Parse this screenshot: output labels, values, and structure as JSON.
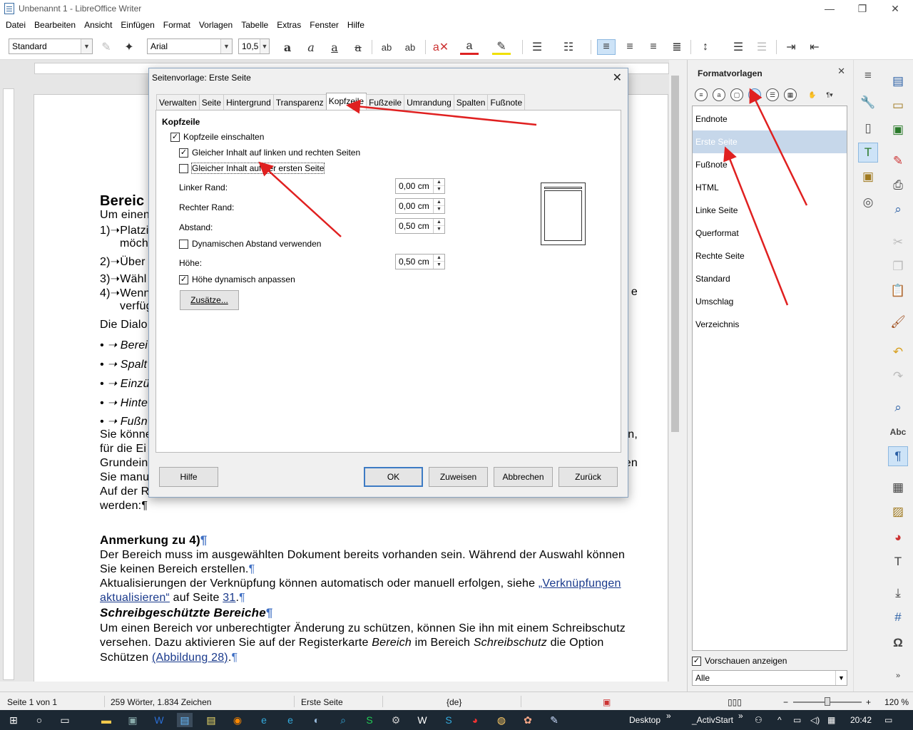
{
  "window": {
    "title": "Unbenannt 1 - LibreOffice Writer",
    "controls": [
      "—",
      "❐",
      "✕"
    ]
  },
  "menu": [
    "Datei",
    "Bearbeiten",
    "Ansicht",
    "Einfügen",
    "Format",
    "Vorlagen",
    "Tabelle",
    "Extras",
    "Fenster",
    "Hilfe"
  ],
  "toolbar": {
    "paragraph_style": "Standard",
    "font_name": "Arial",
    "font_size": "10,5"
  },
  "document": {
    "lines": [
      {
        "text": "Bereic",
        "style": "heading"
      },
      {
        "text": "Um einen"
      },
      {
        "text": "1)➝Platzi"
      },
      {
        "text": "möch",
        "indent": true
      },
      {
        "text": "2)➝Über"
      },
      {
        "text": "3)➝Wähl"
      },
      {
        "text": "4)➝Wenn",
        "tail": "e"
      },
      {
        "text": "verfüg",
        "indent": true
      },
      {
        "text": "Die Dialo"
      },
      {
        "text": "• ➝ Berei",
        "style": "italic"
      },
      {
        "text": "• ➝ Spalt",
        "style": "italic"
      },
      {
        "text": "• ➝ Einzü",
        "style": "italic"
      },
      {
        "text": "• ➝ Hinte",
        "style": "italic"
      },
      {
        "text": "• ➝ Fußn",
        "style": "italic"
      },
      {
        "text": "Sie könne",
        "tail": "en,"
      },
      {
        "text": "für die Ei"
      },
      {
        "text": "Grundein",
        "tail": "en"
      },
      {
        "text": "Sie manu"
      },
      {
        "text": "Auf der R"
      },
      {
        "text": "werden:¶"
      }
    ],
    "pilcrow": "¶",
    "heading2": "Anmerkung zu 4)",
    "para1_a": "Der Bereich muss im ausgewählten Dokument bereits vorhanden sein. Während der Auswahl können",
    "para1_b": "Sie keinen Bereich erstellen.",
    "para2_a": "Aktualisierungen der Verknüpfung können automatisch oder manuell erfolgen, siehe",
    "para2_link_a": "„Verknüpfungen",
    "para2_link_b": "aktualisieren“",
    "para2_b": "auf Seite",
    "para2_page": "31",
    "heading3": "Schreibgeschützte Bereiche",
    "para3_a": "Um einen Bereich vor unberechtigter Änderung zu schützen, können Sie ihn mit einem Schreibschutz",
    "para3_b_pre": "versehen. Dazu aktivieren Sie auf der Registerkarte",
    "para3_b_em1": "Bereich",
    "para3_b_mid": "im Bereich",
    "para3_b_em2": "Schreibschutz",
    "para3_b_post": "die Option",
    "para3_c": "Schützen",
    "para3_c_link": "(Abbildung 28)",
    "para3_c_end": "."
  },
  "dialog": {
    "title": "Seitenvorlage: Erste Seite",
    "tabs": [
      "Verwalten",
      "Seite",
      "Hintergrund",
      "Transparenz",
      "Kopfzeile",
      "Fußzeile",
      "Umrandung",
      "Spalten",
      "Fußnote"
    ],
    "active_tab": "Kopfzeile",
    "section_title": "Kopfzeile",
    "header_on": {
      "label": "Kopfzeile einschalten",
      "checked": true
    },
    "same_lr": {
      "label": "Gleicher Inhalt auf linken und rechten Seiten",
      "checked": true
    },
    "same_first": {
      "label": "Gleicher Inhalt auf der ersten Seite",
      "checked": false
    },
    "left_margin": {
      "label": "Linker Rand:",
      "value": "0,00 cm"
    },
    "right_margin": {
      "label": "Rechter Rand:",
      "value": "0,00 cm"
    },
    "spacing": {
      "label": "Abstand:",
      "value": "0,50 cm"
    },
    "dynamic_spacing": {
      "label": "Dynamischen Abstand verwenden",
      "checked": false
    },
    "height": {
      "label": "Höhe:",
      "value": "0,50 cm"
    },
    "autofit_height": {
      "label": "Höhe dynamisch anpassen",
      "checked": true
    },
    "more_button": "Zusätze...",
    "buttons": {
      "help": "Hilfe",
      "ok": "OK",
      "apply": "Zuweisen",
      "cancel": "Abbrechen",
      "reset": "Zurück"
    }
  },
  "sidebar": {
    "title": "Formatvorlagen",
    "styles": [
      "Endnote",
      "Erste Seite",
      "Fußnote",
      "HTML",
      "Linke Seite",
      "Querformat",
      "Rechte Seite",
      "Standard",
      "Umschlag",
      "Verzeichnis"
    ],
    "selected": "Erste Seite",
    "show_previews": {
      "label": "Vorschauen anzeigen",
      "checked": true
    },
    "filter": "Alle"
  },
  "statusbar": {
    "page": "Seite 1 von 1",
    "words": "259 Wörter, 1.834 Zeichen",
    "page_style": "Erste Seite",
    "language": "{de}",
    "zoom": "120 %"
  },
  "taskbar": {
    "desktop": "Desktop",
    "activstart": "_ActivStart",
    "time": "20:42",
    "chevron": "»"
  },
  "colors": {
    "accent": "#3d7bc4",
    "selection": "#c6d7ea",
    "annotation": "#e02020",
    "taskbar": "#1c2833"
  }
}
